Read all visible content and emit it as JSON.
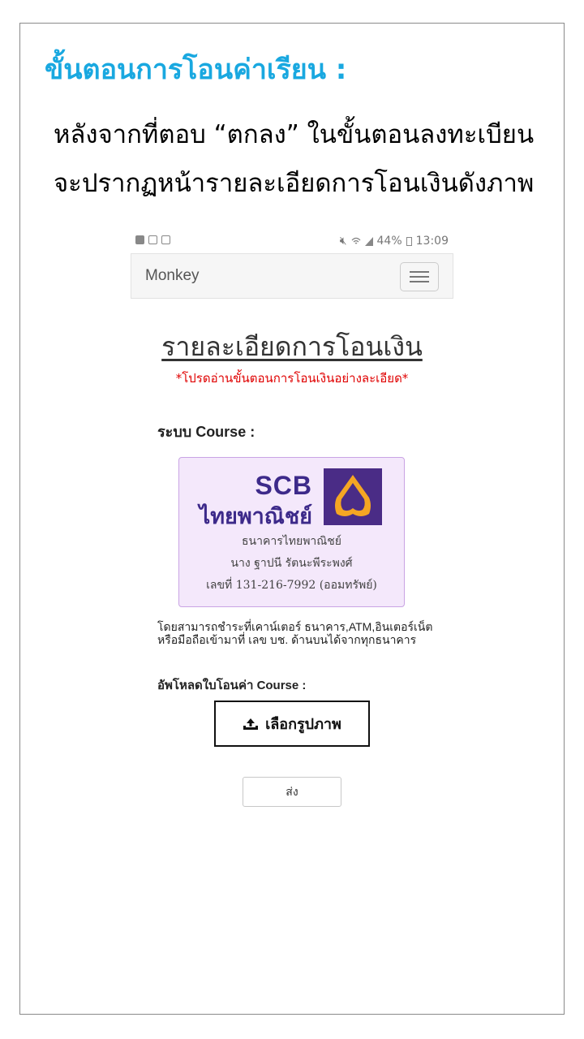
{
  "page": {
    "title": "ขั้นตอนการโอนค่าเรียน :",
    "instruction_line1": "หลังจากที่ตอบ “ตกลง” ในขั้นตอนลงทะเบียน",
    "instruction_line2": "จะปรากฏหน้ารายละเอียดการโอนเงินดังภาพ"
  },
  "phone": {
    "status_bar": {
      "left_icons": [
        "facebook-icon",
        "gallery-icon",
        "screenshot-icon"
      ],
      "right_icons": [
        "mute-icon",
        "wifi-icon",
        "signal-icon",
        "battery-icon"
      ],
      "battery": "44%",
      "time": "13:09"
    },
    "navbar": {
      "brand": "Monkey",
      "menu_icon": "hamburger-icon"
    },
    "heading": "รายละเอียดการโอนเงิน",
    "warning": "*โปรดอ่านขั้นตอนการโอนเงินอย่างละเอียด*",
    "system_label": "ระบบ Course :",
    "bank": {
      "code": "SCB",
      "name_logo": "ไทยพาณิชย์",
      "bank_name": "ธนาคารไทยพาณิชย์",
      "account_name": "นาง ฐาปนี รัตนะพีระพงศ์",
      "account_no": "เลขที่ 131-216-7992 (ออมทรัพย์)",
      "colors": {
        "logo_bg": "#4a2c86",
        "logo_mark": "#f5a623",
        "card_bg": "#f4e8fb",
        "card_border": "#c9a4e4"
      }
    },
    "description": "โดยสามารถชำระที่เคาน์เตอร์ ธนาคาร,ATM,อินเตอร์เน็ต หรือมือถือเข้ามาที่ เลข บช. ด้านบนได้จากทุกธนาคาร",
    "upload_label": "อัพโหลดใบโอนค่า Course :",
    "choose_image_button": "เลือกรูปภาพ",
    "upload_icon": "upload-icon",
    "submit_button": "ส่ง"
  },
  "colors": {
    "title": "#19a8e0",
    "warning": "#e00000"
  }
}
